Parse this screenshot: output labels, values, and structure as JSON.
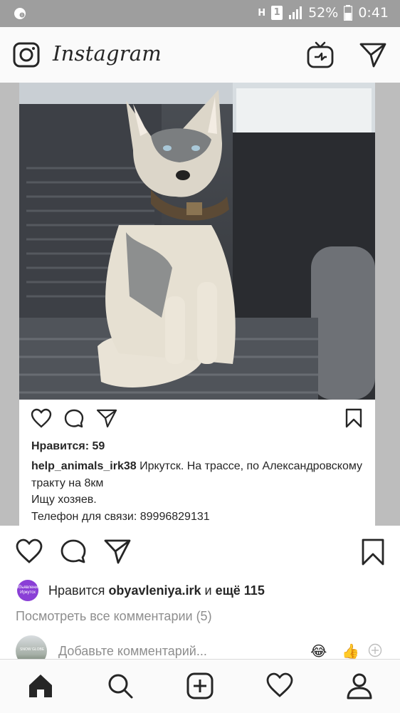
{
  "status_bar": {
    "battery_text": "52%",
    "time": "0:41",
    "sim_badge": "1",
    "network_letter": "H"
  },
  "header": {
    "app_title": "Instagram",
    "icons": [
      "camera-icon",
      "igtv-icon",
      "direct-message-icon"
    ]
  },
  "post_image": {
    "likes_line": "Нравится: 59",
    "caption_user": "help_animals_irk38",
    "caption_text": " Иркутск. На трассе, по Александровскому тракту на 8км",
    "caption_line2": "Ищу хозяев.",
    "caption_line3": "Телефон для связи: 89996829131"
  },
  "post": {
    "liked_prefix": "Нравится ",
    "liked_user": "obyavleniya.irk",
    "liked_middle": " и ",
    "liked_more": "ещё 115",
    "liked_avatar_text": "Объявления Иркутск",
    "view_comments": "Посмотреть все комментарии (5)",
    "comment_placeholder": "Добавьте комментарий...",
    "comment_avatar_text": "SNOW GLOBE",
    "quick_emoji_1": "😂",
    "quick_emoji_2": "👍"
  },
  "nav": {
    "items": [
      "home-icon",
      "search-icon",
      "create-icon",
      "activity-icon",
      "profile-icon"
    ]
  },
  "colors": {
    "status_bar_bg": "#9e9e9e",
    "top_bar_bg": "#fafafa",
    "muted_text": "#8e8e8e",
    "text": "#262626",
    "liked_avatar": "#8a3fd6"
  }
}
